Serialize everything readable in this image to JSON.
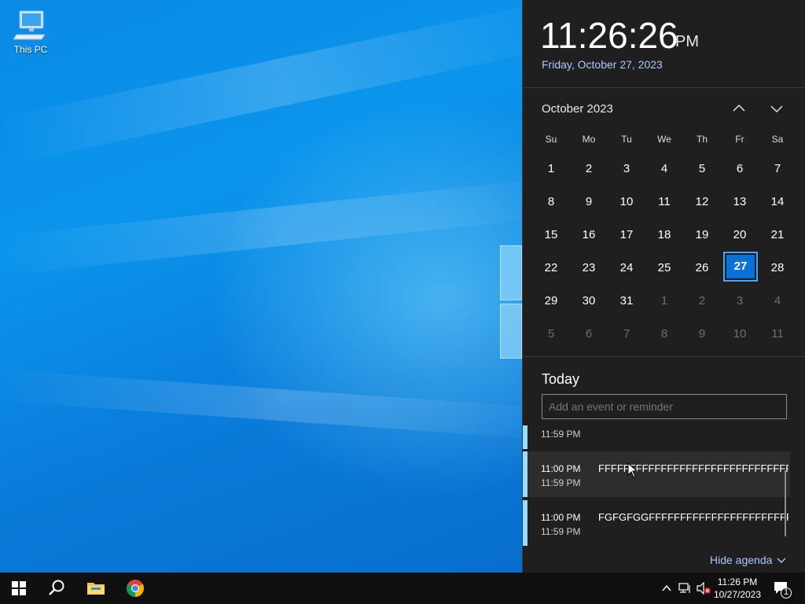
{
  "desktop": {
    "icons": [
      {
        "label": "This PC"
      }
    ]
  },
  "flyout": {
    "time": "11:26:26",
    "ampm": "PM",
    "long_date": "Friday, October 27, 2023",
    "calendar": {
      "month_title": "October 2023",
      "weekdays": [
        "Su",
        "Mo",
        "Tu",
        "We",
        "Th",
        "Fr",
        "Sa"
      ],
      "weeks": [
        [
          {
            "d": "1"
          },
          {
            "d": "2"
          },
          {
            "d": "3"
          },
          {
            "d": "4"
          },
          {
            "d": "5"
          },
          {
            "d": "6"
          },
          {
            "d": "7"
          }
        ],
        [
          {
            "d": "8"
          },
          {
            "d": "9"
          },
          {
            "d": "10"
          },
          {
            "d": "11"
          },
          {
            "d": "12"
          },
          {
            "d": "13"
          },
          {
            "d": "14"
          }
        ],
        [
          {
            "d": "15"
          },
          {
            "d": "16"
          },
          {
            "d": "17"
          },
          {
            "d": "18"
          },
          {
            "d": "19"
          },
          {
            "d": "20"
          },
          {
            "d": "21"
          }
        ],
        [
          {
            "d": "22"
          },
          {
            "d": "23"
          },
          {
            "d": "24"
          },
          {
            "d": "25"
          },
          {
            "d": "26"
          },
          {
            "d": "27",
            "today": true
          },
          {
            "d": "28"
          }
        ],
        [
          {
            "d": "29"
          },
          {
            "d": "30"
          },
          {
            "d": "31"
          },
          {
            "d": "1",
            "other": true
          },
          {
            "d": "2",
            "other": true
          },
          {
            "d": "3",
            "other": true
          },
          {
            "d": "4",
            "other": true
          }
        ],
        [
          {
            "d": "5",
            "other": true
          },
          {
            "d": "6",
            "other": true
          },
          {
            "d": "7",
            "other": true
          },
          {
            "d": "8",
            "other": true
          },
          {
            "d": "9",
            "other": true
          },
          {
            "d": "10",
            "other": true
          },
          {
            "d": "11",
            "other": true
          }
        ]
      ]
    },
    "agenda": {
      "heading": "Today",
      "input_placeholder": "Add an event or reminder",
      "items": [
        {
          "start": "",
          "end": "11:59 PM",
          "title": ""
        },
        {
          "start": "11:00 PM",
          "end": "11:59 PM",
          "title": "FFFFFFFFFFFFFFFFFFFFFFFFFFFFFFFF..."
        },
        {
          "start": "11:00 PM",
          "end": "11:59 PM",
          "title": "FGFGFGGFFFFFFFFFFFFFFFFFFFFFFFFF"
        }
      ],
      "hide_label": "Hide agenda"
    }
  },
  "taskbar": {
    "icons": [
      "windows-start-icon",
      "search-icon",
      "file-explorer-icon",
      "chrome-icon"
    ],
    "tray": {
      "time": "11:26 PM",
      "date": "10/27/2023",
      "notification_count": "1"
    }
  },
  "colors": {
    "accent": "#0a72d6",
    "flyout_bg": "#1f1f1f",
    "link": "#a9c9ff",
    "agenda_bar": "#9adcff"
  }
}
